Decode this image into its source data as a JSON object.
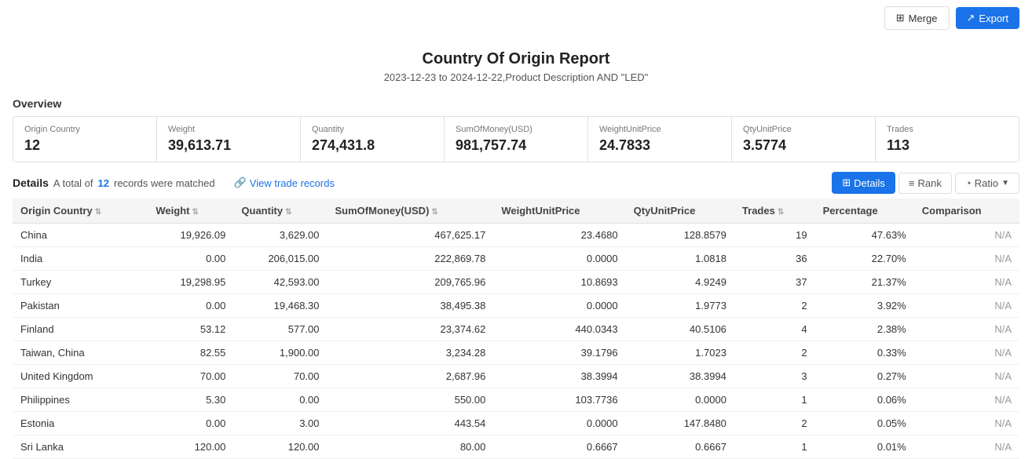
{
  "header": {
    "title": "Country Of Origin Report",
    "subtitle": "2023-12-23 to 2024-12-22,Product Description AND \"LED\""
  },
  "overview": {
    "label": "Overview",
    "merge_label": "Merge",
    "export_label": "Export",
    "stats": [
      {
        "name": "Origin Country",
        "value": "12"
      },
      {
        "name": "Weight",
        "value": "39,613.71"
      },
      {
        "name": "Quantity",
        "value": "274,431.8"
      },
      {
        "name": "SumOfMoney(USD)",
        "value": "981,757.74"
      },
      {
        "name": "WeightUnitPrice",
        "value": "24.7833"
      },
      {
        "name": "QtyUnitPrice",
        "value": "3.5774"
      },
      {
        "name": "Trades",
        "value": "113"
      }
    ]
  },
  "details": {
    "title": "Details",
    "total_text": "A total of",
    "matched_count": "12",
    "records_text": "records were matched",
    "view_link": "View trade records",
    "tab_details": "Details",
    "tab_rank": "Rank",
    "tab_ratio": "Ratio"
  },
  "table": {
    "columns": [
      "Origin Country",
      "Weight",
      "Quantity",
      "SumOfMoney(USD)",
      "WeightUnitPrice",
      "QtyUnitPrice",
      "Trades",
      "Percentage",
      "Comparison"
    ],
    "rows": [
      {
        "country": "China",
        "weight": "19,926.09",
        "quantity": "3,629.00",
        "sum": "467,625.17",
        "wup": "23.4680",
        "qup": "128.8579",
        "trades": "19",
        "pct": "47.63%",
        "cmp": "N/A"
      },
      {
        "country": "India",
        "weight": "0.00",
        "quantity": "206,015.00",
        "sum": "222,869.78",
        "wup": "0.0000",
        "qup": "1.0818",
        "trades": "36",
        "pct": "22.70%",
        "cmp": "N/A"
      },
      {
        "country": "Turkey",
        "weight": "19,298.95",
        "quantity": "42,593.00",
        "sum": "209,765.96",
        "wup": "10.8693",
        "qup": "4.9249",
        "trades": "37",
        "pct": "21.37%",
        "cmp": "N/A"
      },
      {
        "country": "Pakistan",
        "weight": "0.00",
        "quantity": "19,468.30",
        "sum": "38,495.38",
        "wup": "0.0000",
        "qup": "1.9773",
        "trades": "2",
        "pct": "3.92%",
        "cmp": "N/A"
      },
      {
        "country": "Finland",
        "weight": "53.12",
        "quantity": "577.00",
        "sum": "23,374.62",
        "wup": "440.0343",
        "qup": "40.5106",
        "trades": "4",
        "pct": "2.38%",
        "cmp": "N/A"
      },
      {
        "country": "Taiwan, China",
        "weight": "82.55",
        "quantity": "1,900.00",
        "sum": "3,234.28",
        "wup": "39.1796",
        "qup": "1.7023",
        "trades": "2",
        "pct": "0.33%",
        "cmp": "N/A"
      },
      {
        "country": "United Kingdom",
        "weight": "70.00",
        "quantity": "70.00",
        "sum": "2,687.96",
        "wup": "38.3994",
        "qup": "38.3994",
        "trades": "3",
        "pct": "0.27%",
        "cmp": "N/A"
      },
      {
        "country": "Philippines",
        "weight": "5.30",
        "quantity": "0.00",
        "sum": "550.00",
        "wup": "103.7736",
        "qup": "0.0000",
        "trades": "1",
        "pct": "0.06%",
        "cmp": "N/A"
      },
      {
        "country": "Estonia",
        "weight": "0.00",
        "quantity": "3.00",
        "sum": "443.54",
        "wup": "0.0000",
        "qup": "147.8480",
        "trades": "2",
        "pct": "0.05%",
        "cmp": "N/A"
      },
      {
        "country": "Sri Lanka",
        "weight": "120.00",
        "quantity": "120.00",
        "sum": "80.00",
        "wup": "0.6667",
        "qup": "0.6667",
        "trades": "1",
        "pct": "0.01%",
        "cmp": "N/A"
      }
    ]
  }
}
